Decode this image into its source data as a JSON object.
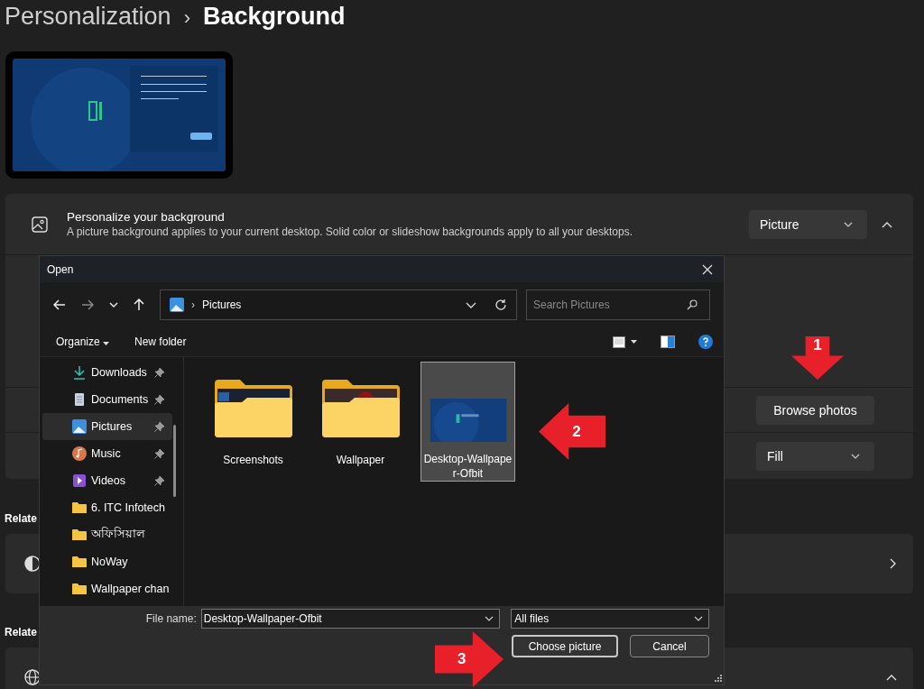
{
  "breadcrumb": {
    "parent": "Personalization",
    "separator": "›",
    "current": "Background"
  },
  "preview": {
    "kind": "picture"
  },
  "background_card": {
    "title": "Personalize your background",
    "description": "A picture background applies to your current desktop. Solid color or slideshow backgrounds apply to all your desktops.",
    "dropdown": "Picture",
    "expanded": true,
    "browse_button": "Browse photos",
    "fit_dropdown": "Fill"
  },
  "related_headings": [
    "Relate",
    "Relate"
  ],
  "dialog": {
    "title": "Open",
    "address": {
      "separator": "›",
      "location": "Pictures"
    },
    "search": {
      "placeholder": "Search Pictures"
    },
    "toolbar": {
      "organize": "Organize",
      "new_folder": "New folder"
    },
    "nav_items": [
      {
        "label": "Downloads",
        "kind": "download",
        "pinned": true,
        "selected": false
      },
      {
        "label": "Documents",
        "kind": "document",
        "pinned": true,
        "selected": false
      },
      {
        "label": "Pictures",
        "kind": "picture",
        "pinned": true,
        "selected": true
      },
      {
        "label": "Music",
        "kind": "music",
        "pinned": true,
        "selected": false
      },
      {
        "label": "Videos",
        "kind": "video",
        "pinned": true,
        "selected": false
      },
      {
        "label": "6. ITC Infotech",
        "kind": "folder",
        "pinned": false,
        "selected": false
      },
      {
        "label": "অফিসিয়াল",
        "kind": "folder",
        "pinned": false,
        "selected": false
      },
      {
        "label": "NoWay",
        "kind": "folder",
        "pinned": false,
        "selected": false
      },
      {
        "label": "Wallpaper chan",
        "kind": "folder",
        "pinned": false,
        "selected": false
      }
    ],
    "files": [
      {
        "name": "Screenshots",
        "kind": "folder",
        "selected": false
      },
      {
        "name": "Wallpaper",
        "kind": "folder",
        "selected": false
      },
      {
        "name": "Desktop-Wallpaper-Ofbit",
        "selected": true
      }
    ],
    "file_name_label": "File name:",
    "file_name": "Desktop-Wallpaper-Ofbit",
    "file_type": "All files",
    "buttons": [
      {
        "label": "Choose picture",
        "default": true
      },
      {
        "label": "Cancel",
        "default": false
      }
    ]
  },
  "annotations": [
    {
      "number": "1"
    },
    {
      "number": "2"
    },
    {
      "number": "3"
    }
  ]
}
